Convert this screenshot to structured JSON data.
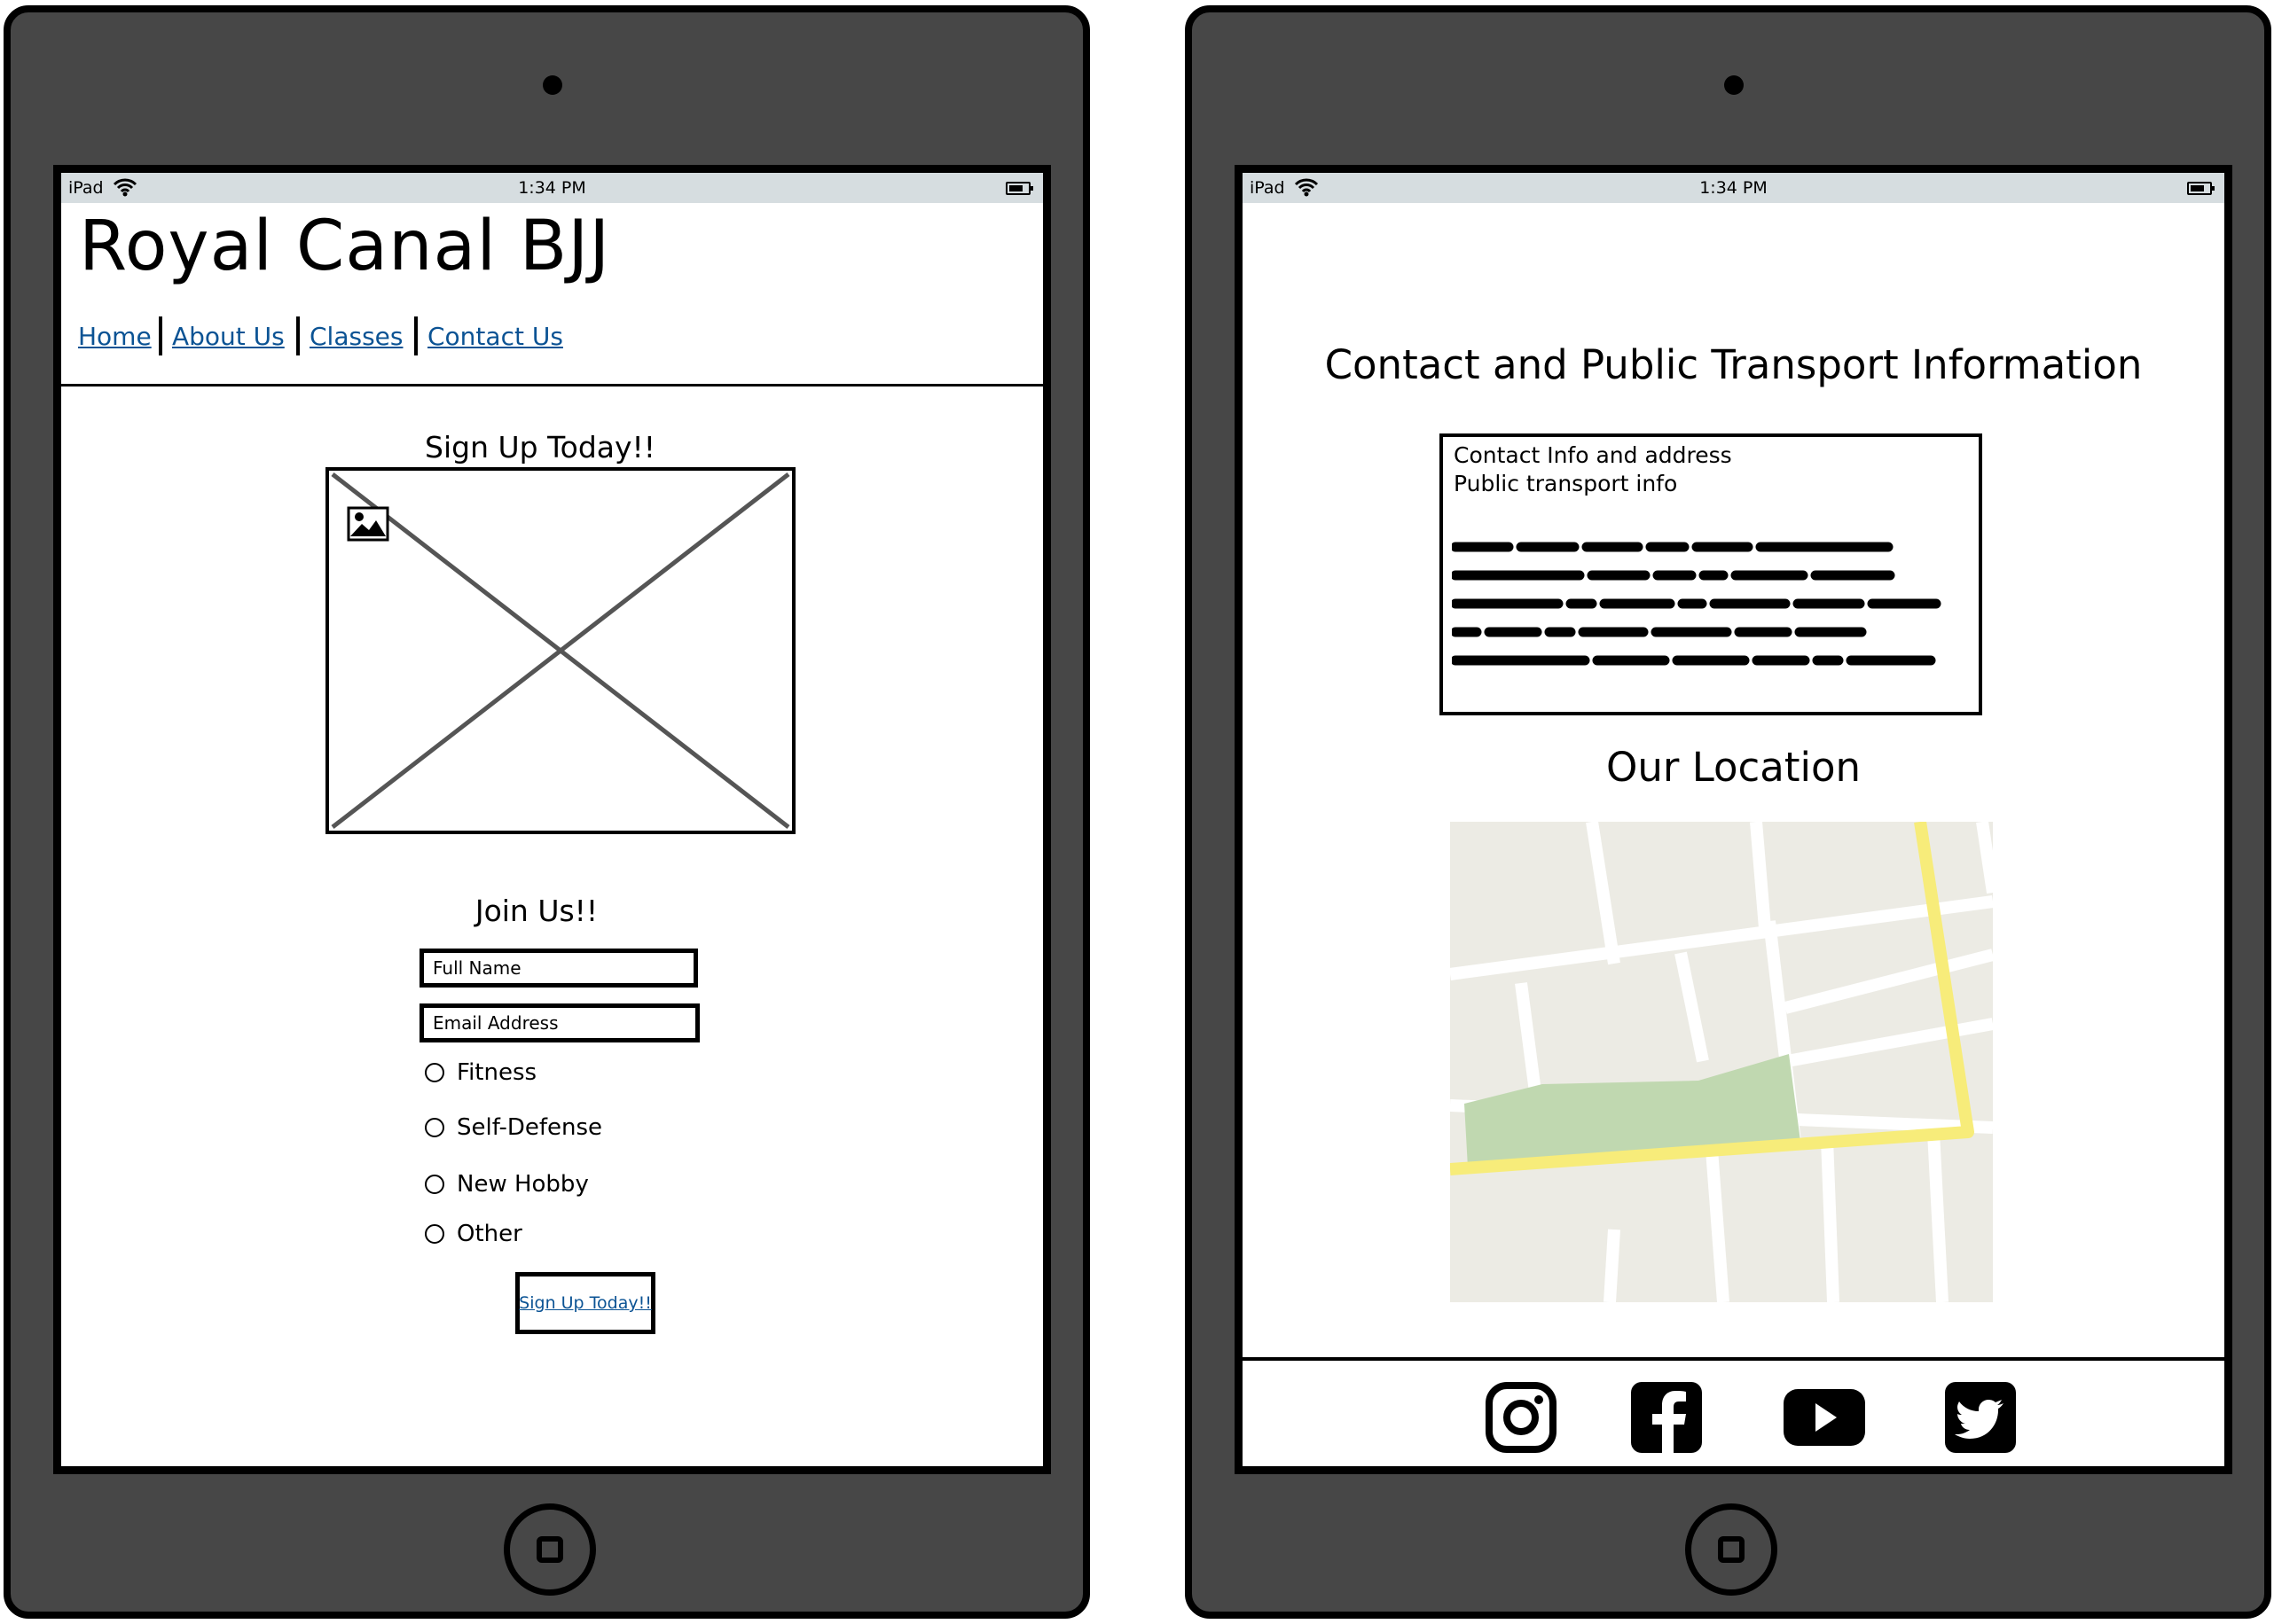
{
  "status_bar": {
    "device": "iPad",
    "time": "1:34 PM"
  },
  "left_screen": {
    "site_title": "Royal Canal BJJ",
    "nav": [
      {
        "label": "Home"
      },
      {
        "label": "About Us"
      },
      {
        "label": "Classes"
      },
      {
        "label": "Contact Us"
      }
    ],
    "hero_heading": "Sign Up Today!!",
    "form_heading": "Join Us!!",
    "form": {
      "full_name_placeholder": "Full Name",
      "email_placeholder": "Email Address",
      "options": [
        {
          "label": "Fitness"
        },
        {
          "label": "Self-Defense"
        },
        {
          "label": "New Hobby"
        },
        {
          "label": "Other"
        }
      ],
      "submit_label": "Sign Up Today!!"
    }
  },
  "right_screen": {
    "contact_heading": "Contact and Public Transport Information",
    "contact_box": {
      "line1": "Contact Info and address",
      "line2": "Public transport info"
    },
    "location_heading": "Our Location",
    "footer_icons": [
      "instagram-icon",
      "facebook-icon",
      "youtube-icon",
      "twitter-icon"
    ]
  },
  "colors": {
    "frame": "#474747",
    "status_bar": "#d6dde0",
    "link": "#0b5394",
    "map_base": "#ecebe4",
    "map_park": "#c0d8b0",
    "map_road": "#f7ec7a"
  }
}
